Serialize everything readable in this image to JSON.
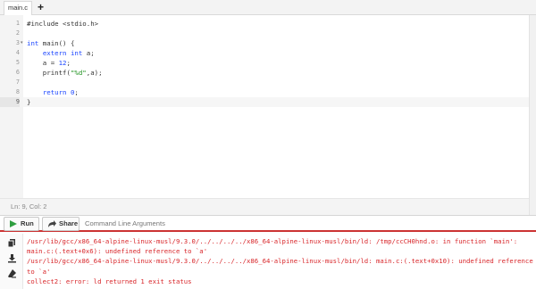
{
  "tabs": [
    {
      "label": "main.c"
    }
  ],
  "add_tab_label": "+",
  "editor": {
    "line_numbers": [
      "1",
      "2",
      "3",
      "4",
      "5",
      "6",
      "7",
      "8",
      "9"
    ],
    "lines": [
      "#include <stdio.h>",
      "",
      "int main() {",
      "    extern int a;",
      "    a = 12;",
      "    printf(\"%d\",a);",
      "",
      "    return 0;",
      "}"
    ],
    "active_line": 9,
    "fold_marker": "▾"
  },
  "status": {
    "cursor": "Ln: 9,  Col: 2"
  },
  "toolbar": {
    "run_label": "Run",
    "share_label": "Share",
    "cli_placeholder": "Command Line Arguments"
  },
  "output": {
    "lines": [
      "/usr/lib/gcc/x86_64-alpine-linux-musl/9.3.0/../../../../x86_64-alpine-linux-musl/bin/ld: /tmp/ccCH0hnd.o: in function `main':",
      "main.c:(.text+0x6): undefined reference to `a'",
      "/usr/lib/gcc/x86_64-alpine-linux-musl/9.3.0/../../../../x86_64-alpine-linux-musl/bin/ld: main.c:(.text+0x10): undefined reference",
      "to `a'",
      "collect2: error: ld returned 1 exit status"
    ]
  },
  "colors": {
    "error": "#d8262a",
    "keyword": "#1b46ff",
    "string": "#1a8f1a",
    "run_icon": "#2e9e3f"
  },
  "icons": [
    "play-icon",
    "share-icon",
    "copy-icon",
    "download-icon",
    "eraser-icon"
  ]
}
